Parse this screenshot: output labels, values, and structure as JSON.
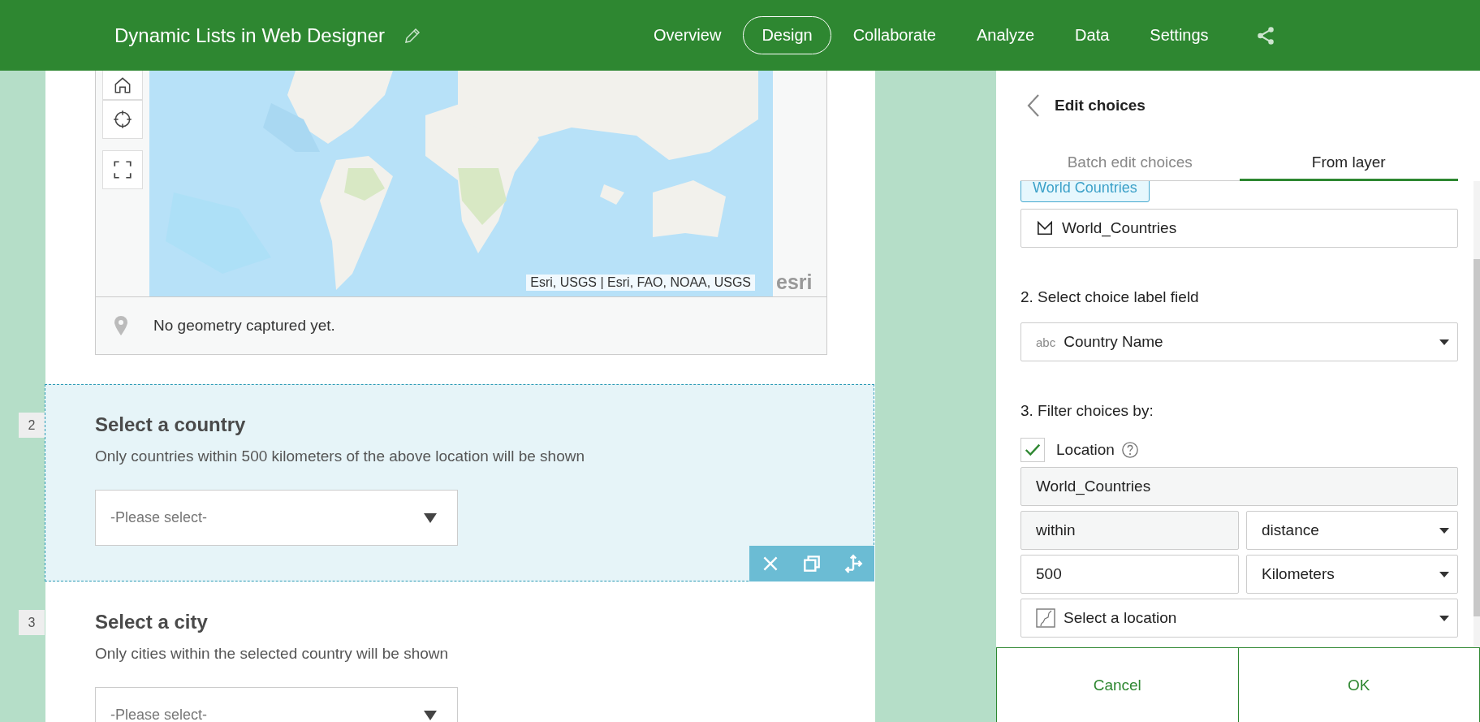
{
  "header": {
    "title": "Dynamic Lists in Web Designer",
    "nav": [
      {
        "label": "Overview",
        "selected": false
      },
      {
        "label": "Design",
        "selected": true
      },
      {
        "label": "Collaborate",
        "selected": false
      },
      {
        "label": "Analyze",
        "selected": false
      },
      {
        "label": "Data",
        "selected": false
      },
      {
        "label": "Settings",
        "selected": false
      }
    ]
  },
  "map": {
    "attribution": "Esri, USGS | Esri, FAO, NOAA, USGS",
    "logo": "esri",
    "status": "No geometry captured yet."
  },
  "questions": [
    {
      "number": "2",
      "title": "Select a country",
      "description": "Only countries within 500 kilometers of the above location will be shown",
      "placeholder": "-Please select-",
      "selected": true
    },
    {
      "number": "3",
      "title": "Select a city",
      "description": "Only cities within the selected country will be shown",
      "placeholder": "-Please select-",
      "selected": false
    }
  ],
  "panel": {
    "title": "Edit choices",
    "tabs": [
      {
        "label": "Batch edit choices",
        "selected": false
      },
      {
        "label": "From layer",
        "selected": true
      }
    ],
    "layer_chip": "World Countries",
    "layer": "World_Countries",
    "label_heading": "2. Select choice label field",
    "field_type": "abc",
    "label_field": "Country Name",
    "filter_heading": "3. Filter choices by:",
    "location_filter": {
      "label": "Location",
      "checked": true
    },
    "filter_layer": "World_Countries",
    "relation": "within",
    "relation_type": "distance",
    "distance": "500",
    "unit": "Kilometers",
    "location": "Select a location"
  },
  "buttons": [
    {
      "label": "Cancel"
    },
    {
      "label": "OK"
    }
  ]
}
